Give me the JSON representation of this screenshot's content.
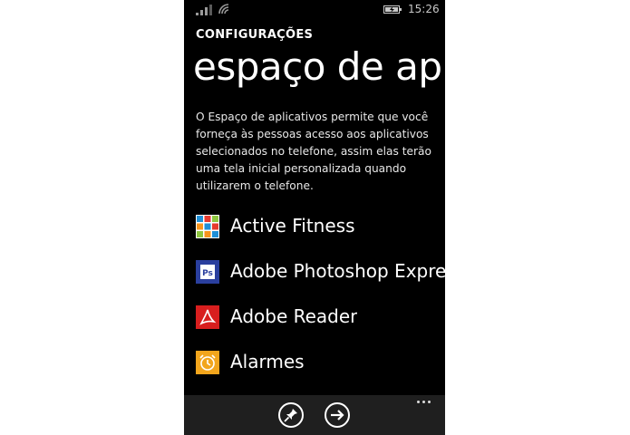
{
  "status_bar": {
    "time": "15:26",
    "signal_icon": "signal-strength-icon",
    "wifi_icon": "wifi-icon",
    "battery_icon": "battery-charging-icon"
  },
  "header": {
    "section": "CONFIGURAÇÕES",
    "title": "espaço de aplicativos"
  },
  "description": "O Espaço de aplicativos permite que você forneça às pessoas acesso aos aplicativos selecionados no telefone, assim elas terão uma tela inicial personalizada quando utilizarem o telefone.",
  "apps": [
    {
      "label": "Active Fitness",
      "icon": "active-fitness-icon",
      "color": "#1f8fd6"
    },
    {
      "label": "Adobe Photoshop Express",
      "icon": "photoshop-express-icon",
      "color": "#2a3f9e"
    },
    {
      "label": "Adobe Reader",
      "icon": "adobe-reader-icon",
      "color": "#d81e1e"
    },
    {
      "label": "Alarmes",
      "icon": "alarm-clock-icon",
      "color": "#f2a51c"
    }
  ],
  "app_bar": {
    "pin_icon": "pin-icon",
    "next_icon": "arrow-right-icon",
    "more_icon": "more-dots-icon"
  },
  "colors": {
    "background": "#000000",
    "app_bar": "#1f1f1f",
    "text": "#ffffff"
  }
}
